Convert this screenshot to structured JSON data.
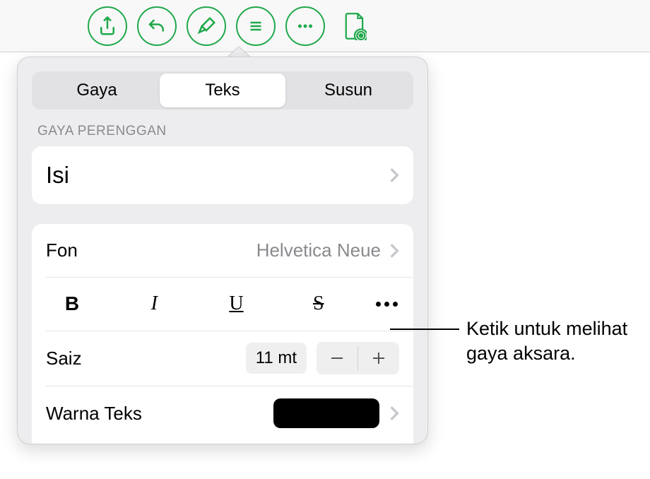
{
  "toolbar": {
    "icons": [
      "share",
      "undo",
      "format-brush",
      "bullets",
      "more",
      "document-view"
    ]
  },
  "tabs": {
    "style": "Gaya",
    "text": "Teks",
    "arrange": "Susun"
  },
  "section": {
    "paragraph_style_label": "GAYA PERENGGAN",
    "paragraph_style_value": "Isi"
  },
  "font": {
    "label": "Fon",
    "value": "Helvetica Neue"
  },
  "styleButtons": {
    "bold": "B",
    "italic": "I",
    "underline": "U",
    "strike": "S"
  },
  "size": {
    "label": "Saiz",
    "value": "11 mt"
  },
  "textColor": {
    "label": "Warna Teks",
    "value": "#000000"
  },
  "callout": {
    "line1": "Ketik untuk melihat",
    "line2": "gaya aksara."
  }
}
